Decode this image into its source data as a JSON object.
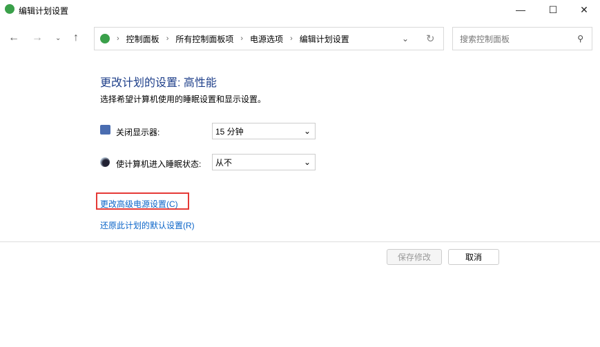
{
  "window": {
    "title": "编辑计划设置"
  },
  "breadcrumb": [
    "控制面板",
    "所有控制面板项",
    "电源选项",
    "编辑计划设置"
  ],
  "search": {
    "placeholder": "搜索控制面板"
  },
  "main": {
    "heading": "更改计划的设置: 高性能",
    "subtitle": "选择希望计算机使用的睡眠设置和显示设置。",
    "display_off": {
      "label": "关闭显示器:",
      "value": "15 分钟"
    },
    "sleep": {
      "label": "使计算机进入睡眠状态:",
      "value": "从不"
    },
    "advanced_link": "更改高级电源设置(C)",
    "restore_link": "还原此计划的默认设置(R)"
  },
  "buttons": {
    "save": "保存修改",
    "cancel": "取消"
  }
}
